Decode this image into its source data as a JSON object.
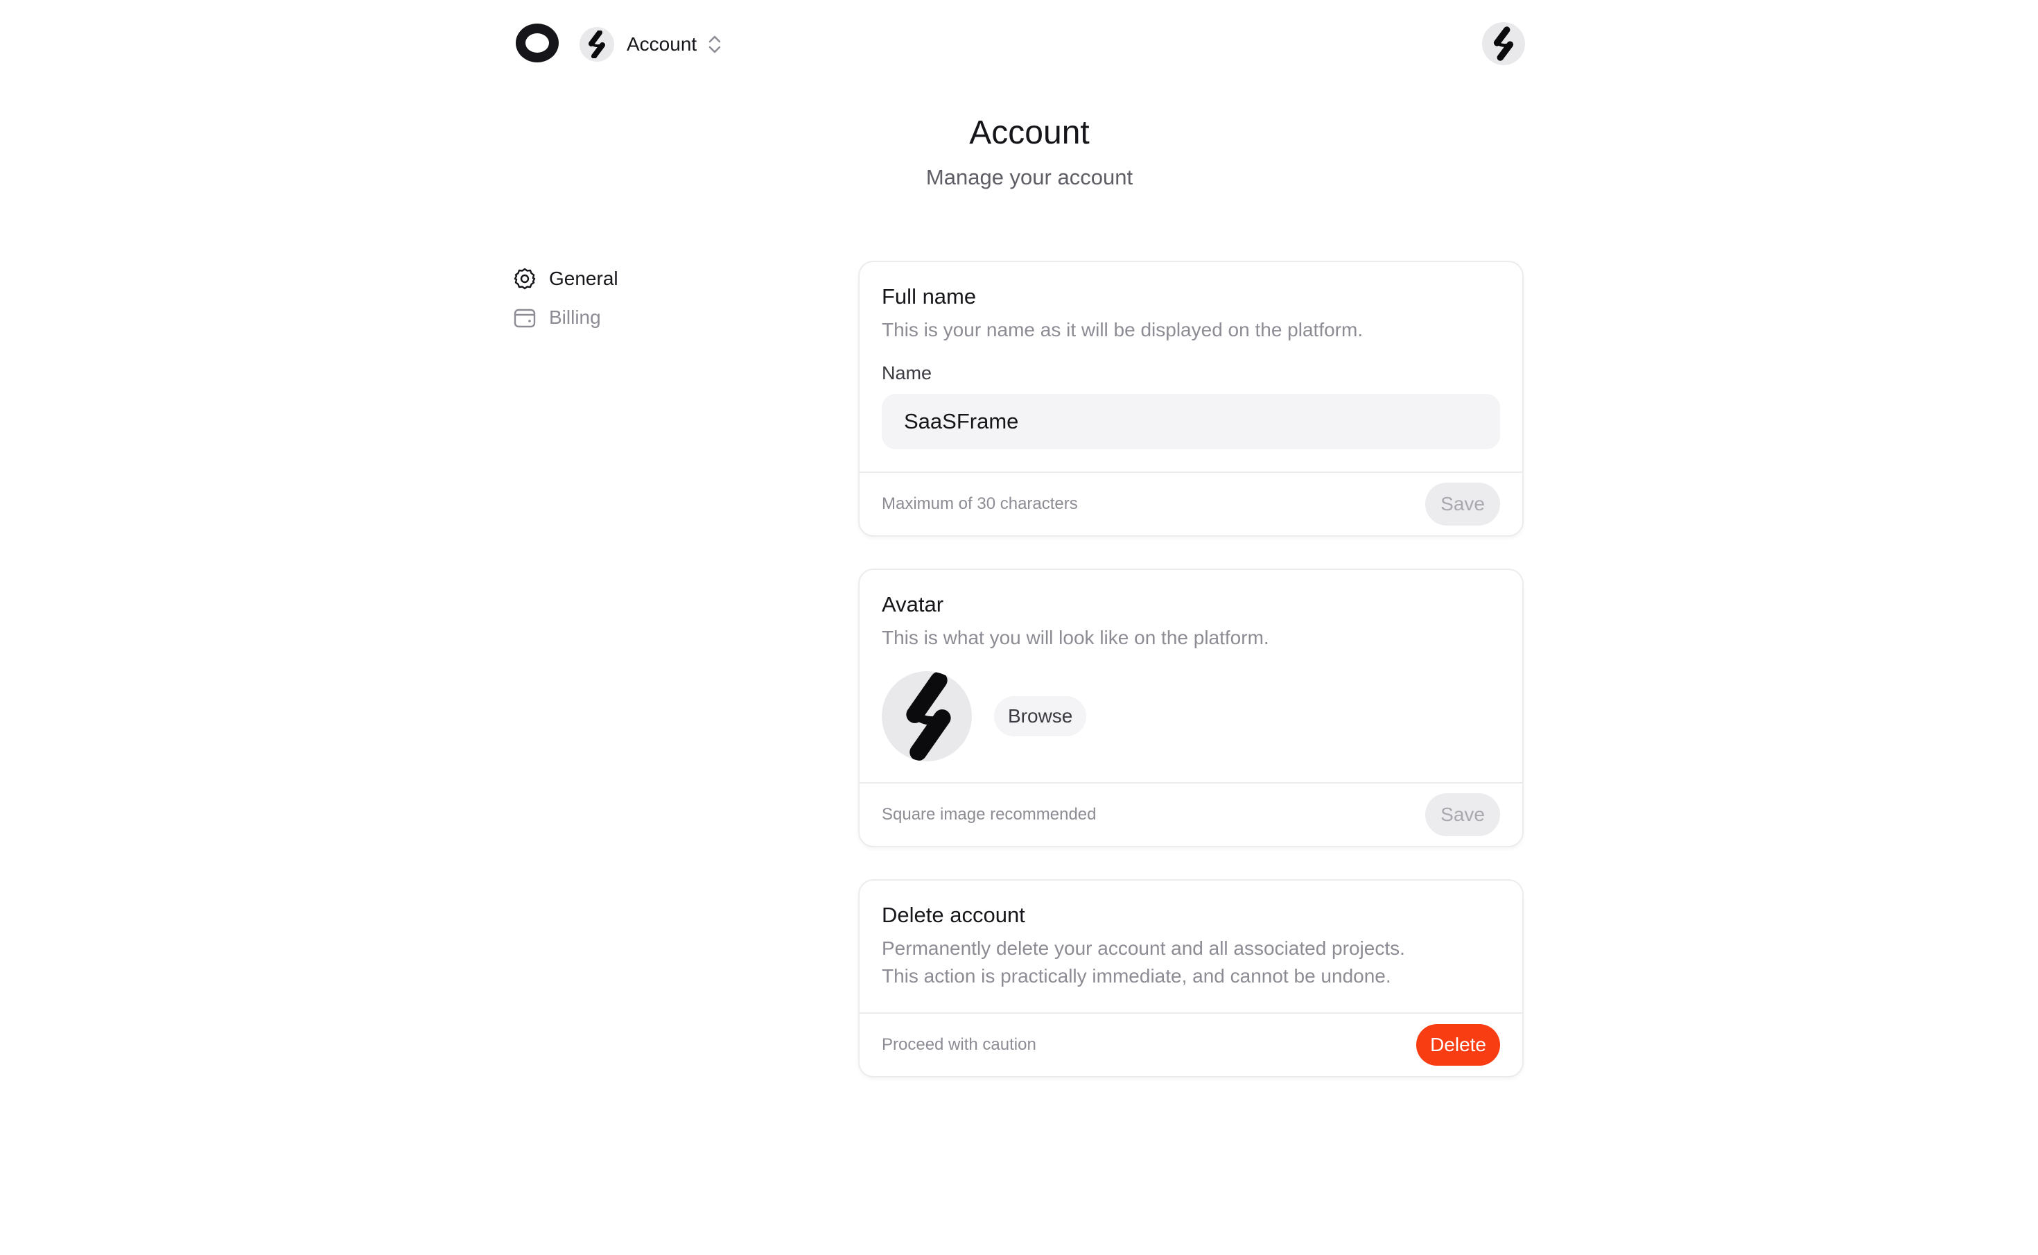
{
  "topbar": {
    "logo_icon": "ring-logo-icon",
    "switcher_label": "Account",
    "switcher_icon": "chevron-up-down-icon"
  },
  "header": {
    "title": "Account",
    "subtitle": "Manage your account"
  },
  "sidebar": {
    "items": [
      {
        "label": "General",
        "icon": "gear-icon",
        "active": true
      },
      {
        "label": "Billing",
        "icon": "wallet-icon",
        "active": false
      }
    ]
  },
  "full_name_card": {
    "title": "Full name",
    "description": "This is your name as it will be displayed on the platform.",
    "field_label": "Name",
    "input_value": "SaaSFrame",
    "footer_note": "Maximum of 30 characters",
    "save_label": "Save"
  },
  "avatar_card": {
    "title": "Avatar",
    "description": "This is what you will look like on the platform.",
    "browse_label": "Browse",
    "footer_note": "Square image recommended",
    "save_label": "Save"
  },
  "delete_card": {
    "title": "Delete account",
    "description_line1": "Permanently delete your account and all associated projects.",
    "description_line2": "This action is practically immediate, and cannot be undone.",
    "footer_note": "Proceed with caution",
    "delete_label": "Delete"
  },
  "colors": {
    "accent_danger": "#f93d13",
    "text_primary": "#16161a",
    "text_muted": "#8c8c94",
    "input_bg": "#f4f4f6",
    "border": "#ececef"
  }
}
